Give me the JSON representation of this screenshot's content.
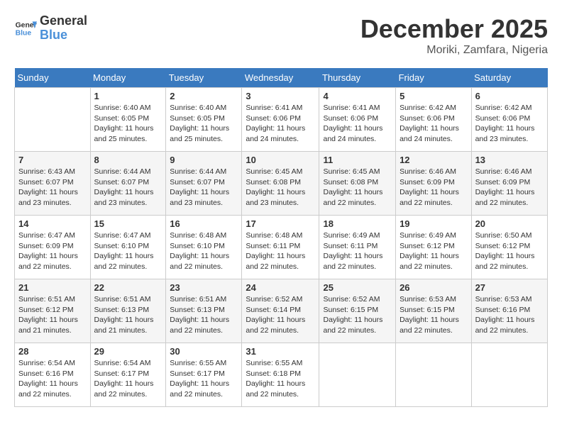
{
  "header": {
    "logo_general": "General",
    "logo_blue": "Blue",
    "month_year": "December 2025",
    "location": "Moriki, Zamfara, Nigeria"
  },
  "days_of_week": [
    "Sunday",
    "Monday",
    "Tuesday",
    "Wednesday",
    "Thursday",
    "Friday",
    "Saturday"
  ],
  "weeks": [
    [
      {
        "day": "",
        "info": ""
      },
      {
        "day": "1",
        "info": "Sunrise: 6:40 AM\nSunset: 6:05 PM\nDaylight: 11 hours and 25 minutes."
      },
      {
        "day": "2",
        "info": "Sunrise: 6:40 AM\nSunset: 6:05 PM\nDaylight: 11 hours and 25 minutes."
      },
      {
        "day": "3",
        "info": "Sunrise: 6:41 AM\nSunset: 6:06 PM\nDaylight: 11 hours and 24 minutes."
      },
      {
        "day": "4",
        "info": "Sunrise: 6:41 AM\nSunset: 6:06 PM\nDaylight: 11 hours and 24 minutes."
      },
      {
        "day": "5",
        "info": "Sunrise: 6:42 AM\nSunset: 6:06 PM\nDaylight: 11 hours and 24 minutes."
      },
      {
        "day": "6",
        "info": "Sunrise: 6:42 AM\nSunset: 6:06 PM\nDaylight: 11 hours and 23 minutes."
      }
    ],
    [
      {
        "day": "7",
        "info": "Sunrise: 6:43 AM\nSunset: 6:07 PM\nDaylight: 11 hours and 23 minutes."
      },
      {
        "day": "8",
        "info": "Sunrise: 6:44 AM\nSunset: 6:07 PM\nDaylight: 11 hours and 23 minutes."
      },
      {
        "day": "9",
        "info": "Sunrise: 6:44 AM\nSunset: 6:07 PM\nDaylight: 11 hours and 23 minutes."
      },
      {
        "day": "10",
        "info": "Sunrise: 6:45 AM\nSunset: 6:08 PM\nDaylight: 11 hours and 23 minutes."
      },
      {
        "day": "11",
        "info": "Sunrise: 6:45 AM\nSunset: 6:08 PM\nDaylight: 11 hours and 22 minutes."
      },
      {
        "day": "12",
        "info": "Sunrise: 6:46 AM\nSunset: 6:09 PM\nDaylight: 11 hours and 22 minutes."
      },
      {
        "day": "13",
        "info": "Sunrise: 6:46 AM\nSunset: 6:09 PM\nDaylight: 11 hours and 22 minutes."
      }
    ],
    [
      {
        "day": "14",
        "info": "Sunrise: 6:47 AM\nSunset: 6:09 PM\nDaylight: 11 hours and 22 minutes."
      },
      {
        "day": "15",
        "info": "Sunrise: 6:47 AM\nSunset: 6:10 PM\nDaylight: 11 hours and 22 minutes."
      },
      {
        "day": "16",
        "info": "Sunrise: 6:48 AM\nSunset: 6:10 PM\nDaylight: 11 hours and 22 minutes."
      },
      {
        "day": "17",
        "info": "Sunrise: 6:48 AM\nSunset: 6:11 PM\nDaylight: 11 hours and 22 minutes."
      },
      {
        "day": "18",
        "info": "Sunrise: 6:49 AM\nSunset: 6:11 PM\nDaylight: 11 hours and 22 minutes."
      },
      {
        "day": "19",
        "info": "Sunrise: 6:49 AM\nSunset: 6:12 PM\nDaylight: 11 hours and 22 minutes."
      },
      {
        "day": "20",
        "info": "Sunrise: 6:50 AM\nSunset: 6:12 PM\nDaylight: 11 hours and 22 minutes."
      }
    ],
    [
      {
        "day": "21",
        "info": "Sunrise: 6:51 AM\nSunset: 6:12 PM\nDaylight: 11 hours and 21 minutes."
      },
      {
        "day": "22",
        "info": "Sunrise: 6:51 AM\nSunset: 6:13 PM\nDaylight: 11 hours and 21 minutes."
      },
      {
        "day": "23",
        "info": "Sunrise: 6:51 AM\nSunset: 6:13 PM\nDaylight: 11 hours and 22 minutes."
      },
      {
        "day": "24",
        "info": "Sunrise: 6:52 AM\nSunset: 6:14 PM\nDaylight: 11 hours and 22 minutes."
      },
      {
        "day": "25",
        "info": "Sunrise: 6:52 AM\nSunset: 6:15 PM\nDaylight: 11 hours and 22 minutes."
      },
      {
        "day": "26",
        "info": "Sunrise: 6:53 AM\nSunset: 6:15 PM\nDaylight: 11 hours and 22 minutes."
      },
      {
        "day": "27",
        "info": "Sunrise: 6:53 AM\nSunset: 6:16 PM\nDaylight: 11 hours and 22 minutes."
      }
    ],
    [
      {
        "day": "28",
        "info": "Sunrise: 6:54 AM\nSunset: 6:16 PM\nDaylight: 11 hours and 22 minutes."
      },
      {
        "day": "29",
        "info": "Sunrise: 6:54 AM\nSunset: 6:17 PM\nDaylight: 11 hours and 22 minutes."
      },
      {
        "day": "30",
        "info": "Sunrise: 6:55 AM\nSunset: 6:17 PM\nDaylight: 11 hours and 22 minutes."
      },
      {
        "day": "31",
        "info": "Sunrise: 6:55 AM\nSunset: 6:18 PM\nDaylight: 11 hours and 22 minutes."
      },
      {
        "day": "",
        "info": ""
      },
      {
        "day": "",
        "info": ""
      },
      {
        "day": "",
        "info": ""
      }
    ]
  ]
}
